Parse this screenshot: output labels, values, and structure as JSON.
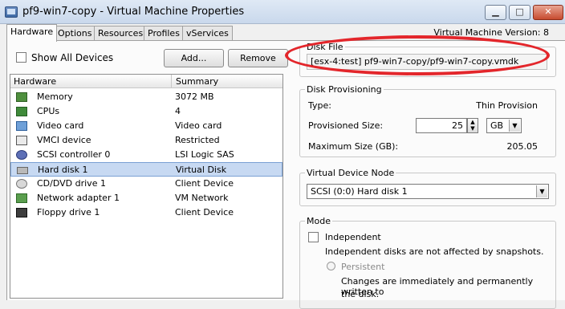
{
  "window": {
    "title": "pf9-win7-copy - Virtual Machine Properties",
    "controls": {
      "minimize": "▁",
      "maximize": "□",
      "close": "✕"
    }
  },
  "tabs": [
    "Hardware",
    "Options",
    "Resources",
    "Profiles",
    "vServices"
  ],
  "vm_version": "Virtual Machine Version: 8",
  "toolbar": {
    "show_all_devices": "Show All Devices",
    "add_button": "Add...",
    "remove_button": "Remove"
  },
  "hardware_table": {
    "columns": [
      "Hardware",
      "Summary"
    ],
    "rows": [
      {
        "name": "Memory",
        "summary": "3072 MB",
        "icon": "memory-icon"
      },
      {
        "name": "CPUs",
        "summary": "4",
        "icon": "cpu-icon"
      },
      {
        "name": "Video card",
        "summary": "Video card",
        "icon": "video-card-icon"
      },
      {
        "name": "VMCI device",
        "summary": "Restricted",
        "icon": "vmci-icon"
      },
      {
        "name": "SCSI controller 0",
        "summary": "LSI Logic SAS",
        "icon": "scsi-icon"
      },
      {
        "name": "Hard disk 1",
        "summary": "Virtual Disk",
        "icon": "hard-disk-icon",
        "selected": true
      },
      {
        "name": "CD/DVD drive 1",
        "summary": "Client Device",
        "icon": "cd-dvd-icon"
      },
      {
        "name": "Network adapter 1",
        "summary": "VM Network",
        "icon": "network-adapter-icon"
      },
      {
        "name": "Floppy drive 1",
        "summary": "Client Device",
        "icon": "floppy-icon"
      }
    ]
  },
  "disk_file": {
    "label": "Disk File",
    "value": "[esx-4:test] pf9-win7-copy/pf9-win7-copy.vmdk",
    "highlight_color": "#e3262b"
  },
  "disk_provisioning": {
    "label": "Disk Provisioning",
    "type_label": "Type:",
    "type_value": "Thin Provision",
    "provisioned_label": "Provisioned Size:",
    "provisioned_value": "25",
    "unit": "GB",
    "max_label": "Maximum Size (GB):",
    "max_value": "205.05"
  },
  "virtual_device_node": {
    "label": "Virtual Device Node",
    "value": "SCSI (0:0) Hard disk 1"
  },
  "mode": {
    "label": "Mode",
    "independent_label": "Independent",
    "independent_desc": "Independent disks are not affected by snapshots.",
    "persistent_label": "Persistent",
    "persistent_desc_1": "Changes are immediately and permanently written to",
    "persistent_desc_2": "the disk."
  }
}
